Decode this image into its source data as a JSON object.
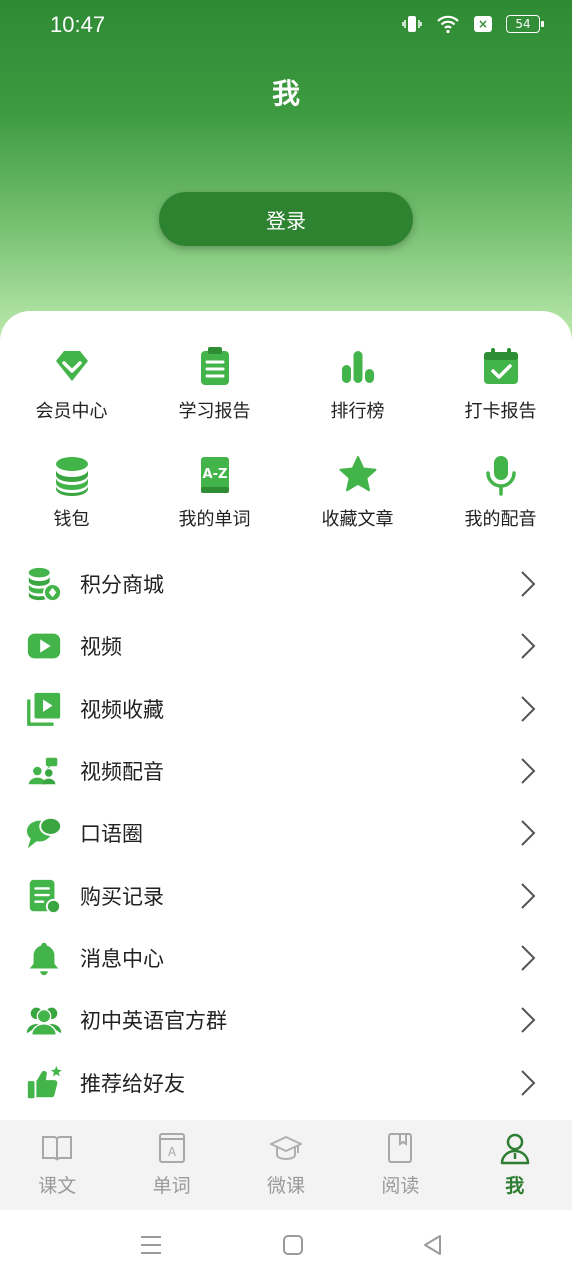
{
  "status": {
    "time": "10:47",
    "battery": "54"
  },
  "page_title": "我",
  "login_label": "登录",
  "colors": {
    "primary": "#2e8331",
    "icon_green": "#3fb34f",
    "inactive": "#9a9a9a"
  },
  "grid": [
    {
      "label": "会员中心",
      "icon": "diamond-icon"
    },
    {
      "label": "学习报告",
      "icon": "clipboard-icon"
    },
    {
      "label": "排行榜",
      "icon": "bar-chart-icon"
    },
    {
      "label": "打卡报告",
      "icon": "calendar-check-icon"
    },
    {
      "label": "钱包",
      "icon": "coin-stack-icon"
    },
    {
      "label": "我的单词",
      "icon": "az-book-icon"
    },
    {
      "label": "收藏文章",
      "icon": "star-icon"
    },
    {
      "label": "我的配音",
      "icon": "microphone-icon"
    }
  ],
  "list": [
    {
      "label": "积分商城",
      "icon": "points-coins-icon"
    },
    {
      "label": "视频",
      "icon": "play-video-icon"
    },
    {
      "label": "视频收藏",
      "icon": "video-collection-icon"
    },
    {
      "label": "视频配音",
      "icon": "dubbing-people-icon"
    },
    {
      "label": "口语圈",
      "icon": "chat-bubbles-icon"
    },
    {
      "label": "购买记录",
      "icon": "receipt-icon"
    },
    {
      "label": "消息中心",
      "icon": "bell-icon"
    },
    {
      "label": "初中英语官方群",
      "icon": "group-icon"
    },
    {
      "label": "推荐给好友",
      "icon": "thumbs-up-star-icon"
    }
  ],
  "tabs": [
    {
      "label": "课文",
      "icon": "book-icon",
      "active": false
    },
    {
      "label": "单词",
      "icon": "word-a-icon",
      "active": false
    },
    {
      "label": "微课",
      "icon": "graduation-cap-icon",
      "active": false
    },
    {
      "label": "阅读",
      "icon": "reading-icon",
      "active": false
    },
    {
      "label": "我",
      "icon": "person-icon",
      "active": true
    }
  ]
}
